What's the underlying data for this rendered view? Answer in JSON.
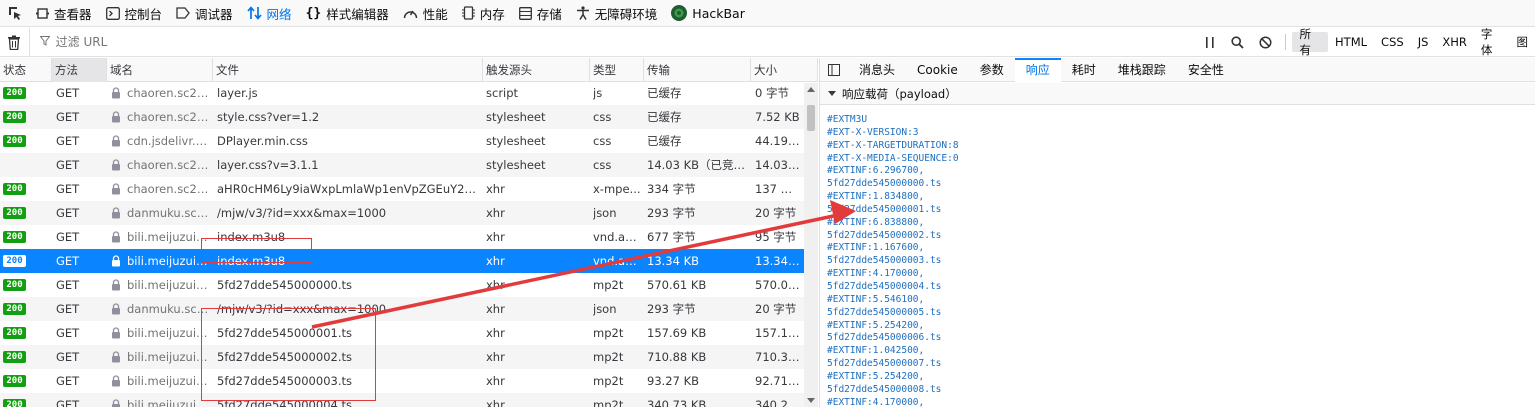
{
  "toolbar": {
    "tabs": [
      {
        "label": "查看器",
        "icon": "inspector-icon"
      },
      {
        "label": "控制台",
        "icon": "console-icon"
      },
      {
        "label": "调试器",
        "icon": "debugger-icon"
      },
      {
        "label": "网络",
        "icon": "network-icon",
        "active": true
      },
      {
        "label": "样式编辑器",
        "icon": "style-editor-icon"
      },
      {
        "label": "性能",
        "icon": "performance-icon"
      },
      {
        "label": "内存",
        "icon": "memory-icon"
      },
      {
        "label": "存储",
        "icon": "storage-icon"
      },
      {
        "label": "无障碍环境",
        "icon": "accessibility-icon"
      },
      {
        "label": "HackBar",
        "icon": "hackbar-icon"
      }
    ]
  },
  "filter": {
    "placeholder": "过滤 URL",
    "types": [
      "所有",
      "HTML",
      "CSS",
      "JS",
      "XHR",
      "字体",
      "图"
    ],
    "active_type": "所有"
  },
  "table": {
    "headers": {
      "status": "状态",
      "method": "方法",
      "domain": "域名",
      "file": "文件",
      "cause": "触发源头",
      "type": "类型",
      "transferred": "传输",
      "size": "大小"
    },
    "rows": [
      {
        "status": "200",
        "method": "GET",
        "domain": "chaoren.sc2yu...",
        "file": "layer.js",
        "cause": "script",
        "type": "js",
        "transferred": "已缓存",
        "size": "0 字节"
      },
      {
        "status": "200",
        "method": "GET",
        "domain": "chaoren.sc2yu...",
        "file": "style.css?ver=1.2",
        "cause": "stylesheet",
        "type": "css",
        "transferred": "已缓存",
        "size": "7.52 KB"
      },
      {
        "status": "200",
        "method": "GET",
        "domain": "cdn.jsdelivr.net",
        "file": "DPlayer.min.css",
        "cause": "stylesheet",
        "type": "css",
        "transferred": "已缓存",
        "size": "44.19 KB"
      },
      {
        "status": "",
        "method": "GET",
        "domain": "chaoren.sc2yu...",
        "file": "layer.css?v=3.1.1",
        "cause": "stylesheet",
        "type": "css",
        "transferred": "14.03 KB（已竞速）",
        "size": "14.03 KB"
      },
      {
        "status": "200",
        "method": "GET",
        "domain": "chaoren.sc2yu...",
        "file": "aHR0cHM6Ly9iaWxpLmlaWp1enVpZGEuY29tL...",
        "cause": "xhr",
        "type": "x-mpe...",
        "transferred": "334 字节",
        "size": "137 字节"
      },
      {
        "status": "200",
        "method": "GET",
        "domain": "danmuku.sc2y...",
        "file": "/mjw/v3/?id=xxx&max=1000",
        "cause": "xhr",
        "type": "json",
        "transferred": "293 字节",
        "size": "20 字节"
      },
      {
        "status": "200",
        "method": "GET",
        "domain": "bili.meijuzuida...",
        "file": "index.m3u8",
        "cause": "xhr",
        "type": "vnd.ap...",
        "transferred": "677 字节",
        "size": "95 字节"
      },
      {
        "status": "200",
        "method": "GET",
        "domain": "bili.meijuzuida...",
        "file": "index.m3u8",
        "cause": "xhr",
        "type": "vnd.ap...",
        "transferred": "13.34 KB",
        "size": "13.34 KB",
        "selected": true
      },
      {
        "status": "200",
        "method": "GET",
        "domain": "bili.meijuzuida...",
        "file": "5fd27dde545000000.ts",
        "cause": "xhr",
        "type": "mp2t",
        "transferred": "570.61 KB",
        "size": "570.06 ..."
      },
      {
        "status": "200",
        "method": "GET",
        "domain": "danmuku.sc2y...",
        "file": "/mjw/v3/?id=xxx&max=1000",
        "cause": "xhr",
        "type": "json",
        "transferred": "293 字节",
        "size": "20 字节"
      },
      {
        "status": "200",
        "method": "GET",
        "domain": "bili.meijuzuida...",
        "file": "5fd27dde545000001.ts",
        "cause": "xhr",
        "type": "mp2t",
        "transferred": "157.69 KB",
        "size": "157.16 ..."
      },
      {
        "status": "200",
        "method": "GET",
        "domain": "bili.meijuzuida...",
        "file": "5fd27dde545000002.ts",
        "cause": "xhr",
        "type": "mp2t",
        "transferred": "710.88 KB",
        "size": "710.32 ..."
      },
      {
        "status": "200",
        "method": "GET",
        "domain": "bili.meijuzuida...",
        "file": "5fd27dde545000003.ts",
        "cause": "xhr",
        "type": "mp2t",
        "transferred": "93.27 KB",
        "size": "92.71 KB"
      },
      {
        "status": "200",
        "method": "GET",
        "domain": "bili.meijuzuida...",
        "file": "5fd27dde545000004.ts",
        "cause": "xhr",
        "type": "mp2t",
        "transferred": "340.73 KB",
        "size": "340.20 ..."
      }
    ]
  },
  "panel": {
    "tabs": [
      "消息头",
      "Cookie",
      "参数",
      "响应",
      "耗时",
      "堆栈跟踪",
      "安全性"
    ],
    "active_tab": "响应",
    "payload_label": "响应载荷（payload）",
    "payload_lines": [
      "#EXTM3U",
      "#EXT-X-VERSION:3",
      "#EXT-X-TARGETDURATION:8",
      "#EXT-X-MEDIA-SEQUENCE:0",
      "#EXTINF:6.296700,",
      "5fd27dde545000000.ts",
      "#EXTINF:1.834800,",
      "5fd27dde545000001.ts",
      "#EXTINF:6.838800,",
      "5fd27dde545000002.ts",
      "#EXTINF:1.167600,",
      "5fd27dde545000003.ts",
      "#EXTINF:4.170000,",
      "5fd27dde545000004.ts",
      "#EXTINF:5.546100,",
      "5fd27dde545000005.ts",
      "#EXTINF:5.254200,",
      "5fd27dde545000006.ts",
      "#EXTINF:1.042500,",
      "5fd27dde545000007.ts",
      "#EXTINF:5.254200,",
      "5fd27dde545000008.ts",
      "#EXTINF:4.170000,"
    ]
  },
  "colors": {
    "accent": "#0a84ff",
    "status_ok": "#12a010",
    "annotation": "#e23b3b",
    "payload_text": "#1f6fc0"
  }
}
